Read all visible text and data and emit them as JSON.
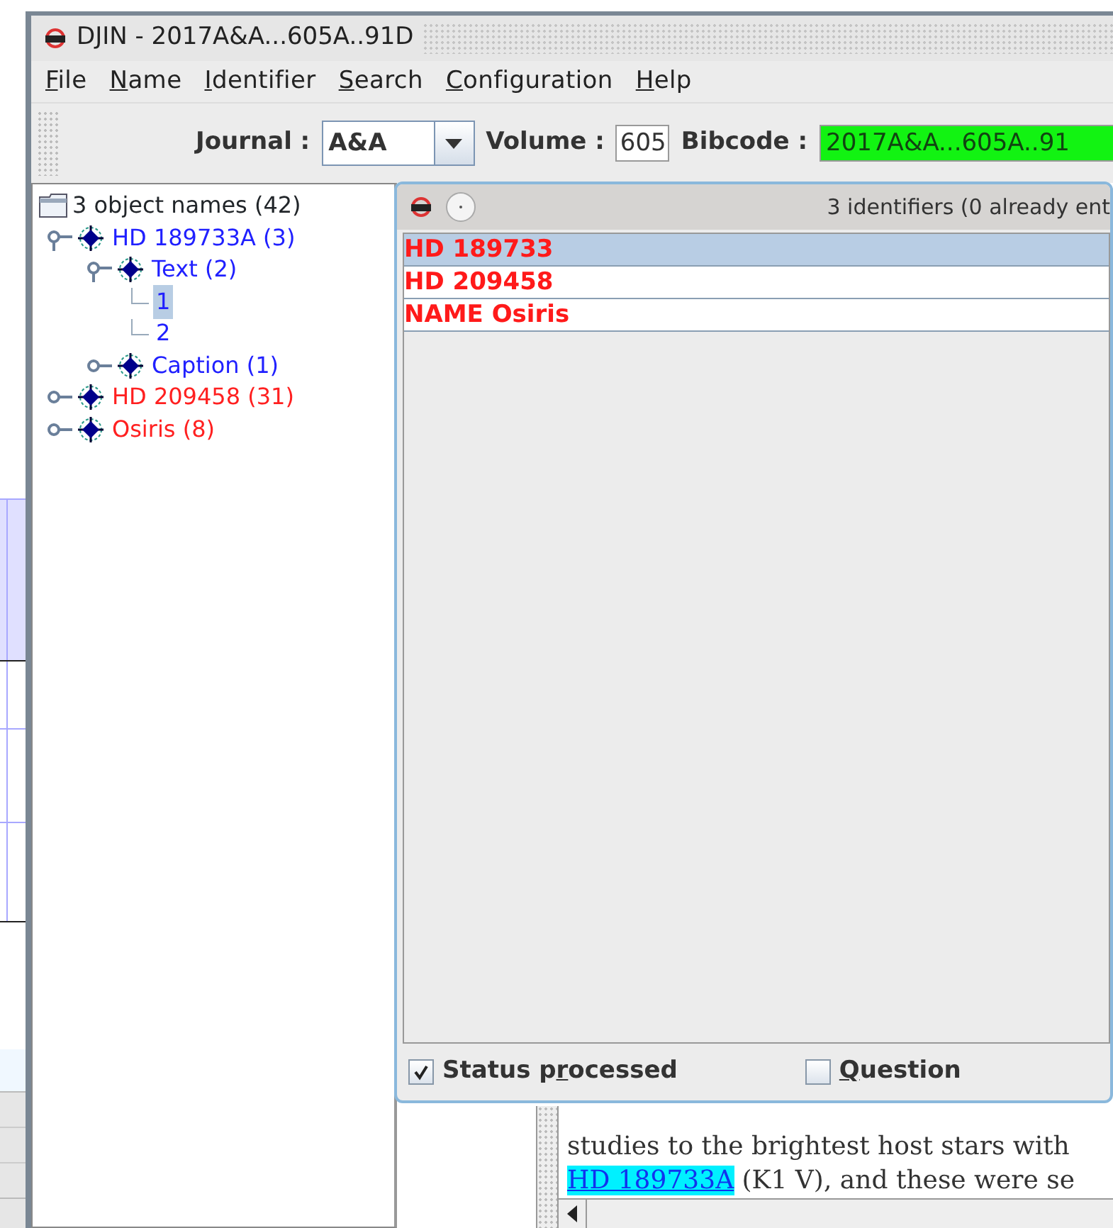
{
  "window": {
    "title": "DJIN - 2017A&A...605A..91D"
  },
  "menu": [
    {
      "key": "F",
      "after": "ile"
    },
    {
      "key": "N",
      "after": "ame"
    },
    {
      "key": "I",
      "after": "dentifier"
    },
    {
      "key": "S",
      "after": "earch"
    },
    {
      "key": "C",
      "after": "onfiguration"
    },
    {
      "key": "H",
      "after": "elp"
    }
  ],
  "toolbar": {
    "journal_label": "Journal :",
    "journal_value": "A&A",
    "volume_label": "Volume :",
    "volume_value": "605",
    "bibcode_label": "Bibcode :",
    "bibcode_value": "2017A&A...605A..91"
  },
  "tree": {
    "label": "3 object names (42)",
    "children": [
      {
        "label": "HD 189733A (3)",
        "color": "#2020ff",
        "expanded": true,
        "selected": false,
        "children": [
          {
            "label": "Text (2)",
            "color": "#2020ff",
            "expanded": true,
            "selected": false,
            "children": [
              {
                "label": "1",
                "color": "#2020ff",
                "selected": true
              },
              {
                "label": "2",
                "color": "#2020ff",
                "selected": false
              }
            ]
          },
          {
            "label": "Caption (1)",
            "color": "#2020ff",
            "expanded": false,
            "selected": false
          }
        ]
      },
      {
        "label": "HD 209458 (31)",
        "color": "#ff2020",
        "expanded": false,
        "selected": false
      },
      {
        "label": "Osiris (8)",
        "color": "#ff2020",
        "expanded": false,
        "selected": false
      }
    ]
  },
  "identifiers_dialog": {
    "summary": "3 identifiers (0 already ent",
    "rows": [
      {
        "label": "HD 189733",
        "selected": true
      },
      {
        "label": "HD 209458",
        "selected": false
      },
      {
        "label": "NAME Osiris",
        "selected": false
      }
    ],
    "checkboxes": [
      {
        "before": "Status p",
        "key": "r",
        "after": "ocessed",
        "checked": true
      },
      {
        "key": "Q",
        "after": "uestion",
        "checked": false
      }
    ]
  },
  "article_text": {
    "lines": [
      {
        "text": "studies to the brightest host stars with"
      },
      {
        "link": "HD 189733A",
        "text": " (K1 V), and these were se"
      }
    ]
  }
}
